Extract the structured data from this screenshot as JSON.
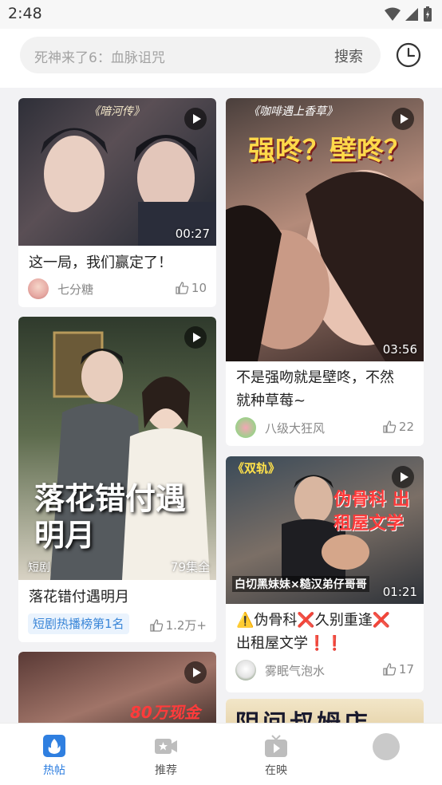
{
  "status": {
    "time": "2:48"
  },
  "search": {
    "placeholder": "死神来了6：血脉诅咒",
    "button": "搜索"
  },
  "cards": [
    {
      "title": "这一局，我们赢定了！",
      "duration": "00:27",
      "author": "七分糖",
      "likes": "10",
      "poster_text": "《暗河传》"
    },
    {
      "title_line1": "不是强吻就是壁咚，不然",
      "title_line2": "就种草莓~",
      "duration": "03:56",
      "author": "八级大狂风",
      "likes": "22",
      "poster_text": "《咖啡遇上香草》",
      "poster_big": "强咚？壁咚？"
    },
    {
      "title": "落花错付遇明月",
      "tag": "短剧",
      "episodes": "79集全",
      "rank": "短剧热播榜第1名",
      "likes": "1.2万+",
      "poster_big": "落花错付遇明月"
    },
    {
      "title_line1": "⚠️伪骨科❌久别重逢❌",
      "title_line2": "出租屋文学❗️❗️",
      "duration": "01:21",
      "author": "雾眠气泡水",
      "likes": "17",
      "poster_text": "《双轨》",
      "poster_big": "伪骨科 出租屋文学",
      "poster_bottom": "白切黑妹妹×糙汉弟仔哥哥"
    },
    {
      "poster_big": "80万现金"
    },
    {
      "poster_big": "阴间叔姆店"
    }
  ],
  "nav": [
    {
      "label": "热帖"
    },
    {
      "label": "推荐"
    },
    {
      "label": "在映"
    },
    {
      "label": ""
    }
  ],
  "colors": {
    "accent": "#2f7fe0",
    "background": "#f2f2f4"
  }
}
